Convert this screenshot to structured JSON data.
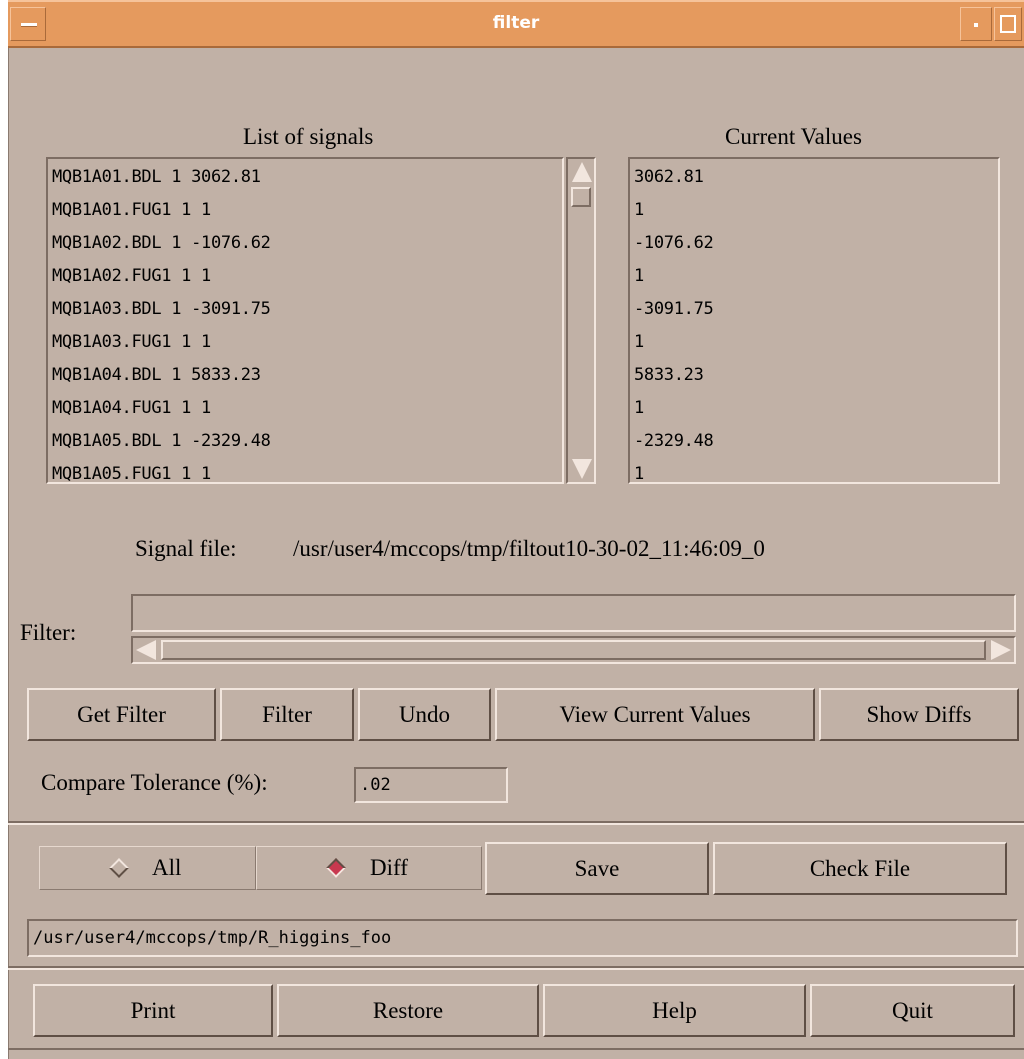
{
  "window": {
    "title": "filter"
  },
  "signals": {
    "list_label": "List of signals",
    "values_label": "Current Values",
    "items": [
      "MQB1A01.BDL 1 3062.81",
      "MQB1A01.FUG1 1 1",
      "MQB1A02.BDL 1 -1076.62",
      "MQB1A02.FUG1 1 1",
      "MQB1A03.BDL 1 -3091.75",
      "MQB1A03.FUG1 1 1",
      "MQB1A04.BDL 1 5833.23",
      "MQB1A04.FUG1 1 1",
      "MQB1A05.BDL 1 -2329.48",
      "MQB1A05.FUG1 1 1"
    ],
    "values": [
      "3062.81",
      "1",
      "-1076.62",
      "1",
      "-3091.75",
      "1",
      "5833.23",
      "1",
      "-2329.48",
      "1"
    ]
  },
  "signal_file": {
    "label": "Signal file:",
    "path": "/usr/user4/mccops/tmp/filtout10-30-02_11:46:09_0"
  },
  "filter": {
    "label": "Filter:",
    "value": ""
  },
  "buttons": {
    "get_filter": "Get Filter",
    "filter": "Filter",
    "undo": "Undo",
    "view_current_values": "View Current Values",
    "show_diffs": "Show Diffs"
  },
  "tolerance": {
    "label": "Compare Tolerance (%):",
    "value": ".02"
  },
  "compare": {
    "all_label": "All",
    "diff_label": "Diff",
    "selected": "Diff",
    "save": "Save",
    "check_file": "Check File",
    "path": "/usr/user4/mccops/tmp/R_higgins_foo"
  },
  "footer": {
    "print": "Print",
    "restore": "Restore",
    "help": "Help",
    "quit": "Quit"
  },
  "colors": {
    "window_bg": "#c1b1a6",
    "titlebar": "#e59a5e",
    "radio_selected": "#c8384f"
  }
}
